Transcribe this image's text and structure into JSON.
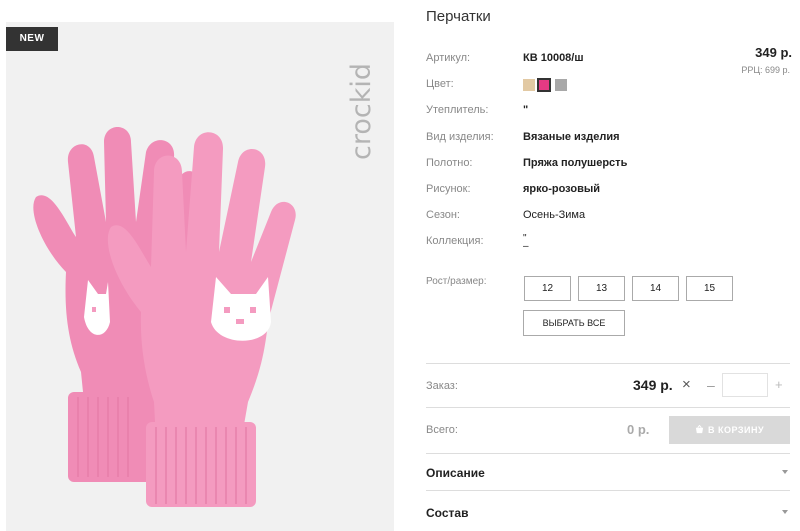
{
  "badge": "NEW",
  "brand": "crockid",
  "product": {
    "title": "Перчатки",
    "price": "349 р.",
    "rrc": "РРЦ: 699 р."
  },
  "specs": [
    {
      "label": "Артикул:",
      "value": "КВ 10008/ш"
    },
    {
      "label": "Цвет:",
      "value": ""
    },
    {
      "label": "Утеплитель:",
      "value": "\""
    },
    {
      "label": "Вид изделия:",
      "value": "Вязаные изделия"
    },
    {
      "label": "Полотно:",
      "value": "Пряжа полушерсть"
    },
    {
      "label": "Рисунок:",
      "value": "ярко-розовый"
    },
    {
      "label": "Сезон:",
      "value": "Осень-Зима"
    },
    {
      "label": "Коллекция:",
      "value": "\"\n–"
    }
  ],
  "colors": [
    "#e2c9a3",
    "#e53a83",
    "#a8a8a8"
  ],
  "sizes": {
    "label": "Рост/размер:",
    "options": [
      "12",
      "13",
      "14",
      "15"
    ],
    "select_all": "ВЫБРАТЬ ВСЕ"
  },
  "order": {
    "label": "Заказ:",
    "price": "349 р.",
    "remove": "×",
    "minus": "–",
    "qty": "",
    "plus": "+"
  },
  "total": {
    "label": "Всего:",
    "price": "0 р.",
    "cart_button": "В КОРЗИНУ"
  },
  "accordions": [
    "Описание",
    "Состав"
  ]
}
